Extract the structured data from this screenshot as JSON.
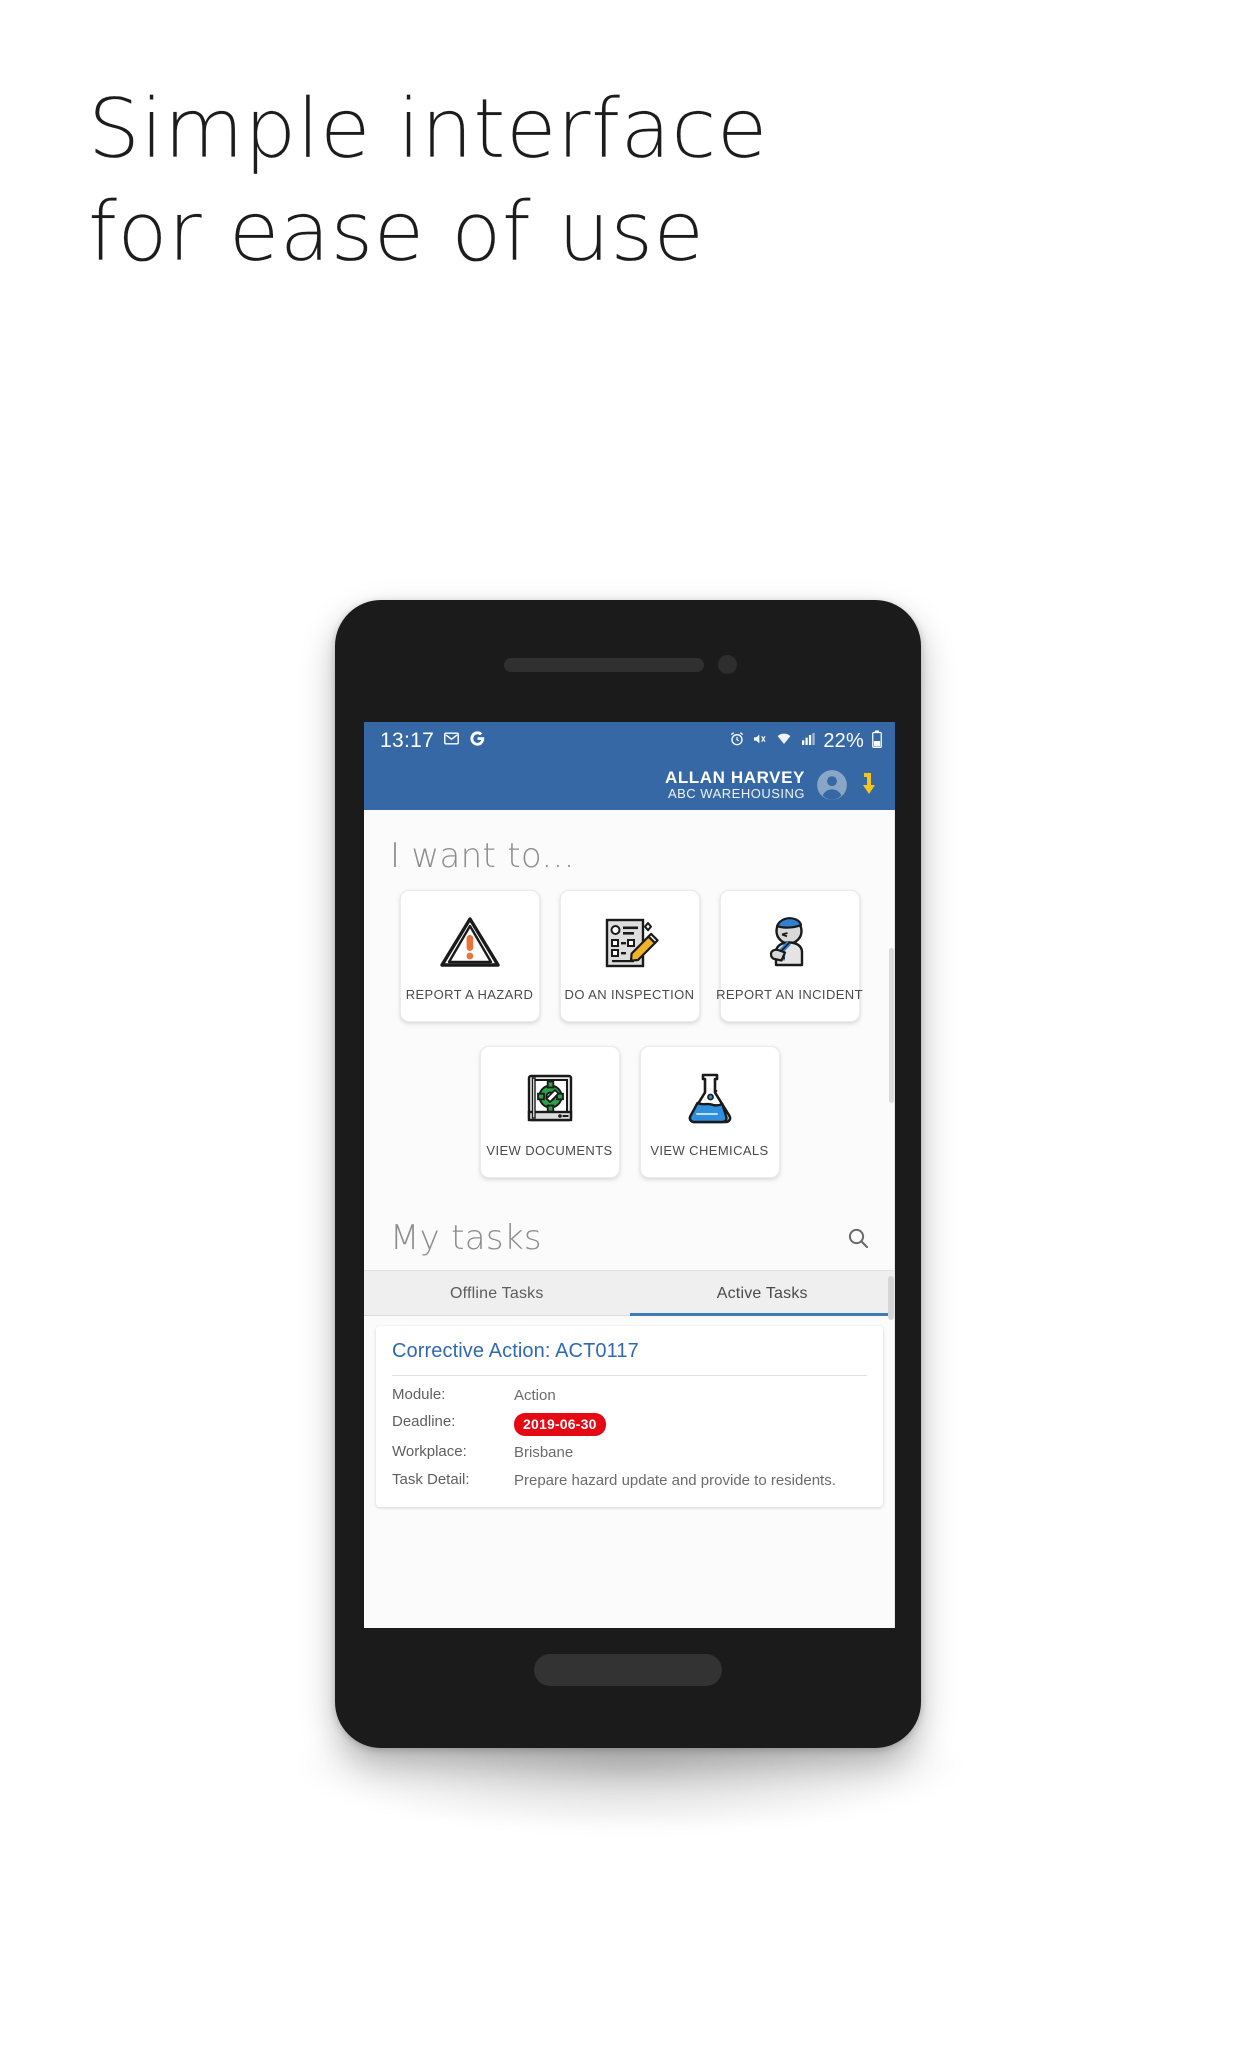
{
  "headline": {
    "line1": "Simple interface",
    "line2": "for ease of use"
  },
  "phone": {
    "statusbar": {
      "time": "13:17",
      "battery_percent": "22%",
      "icons": [
        "mail-icon",
        "google-icon",
        "alarm-icon",
        "mute-icon",
        "wifi-icon",
        "signal-icon",
        "battery-icon"
      ]
    },
    "appbar": {
      "user_name": "ALLAN HARVEY",
      "org_name": "ABC WAREHOUSING",
      "avatar_icon": "account-circle-icon",
      "logout_icon": "logout-arrow-icon",
      "accent_color": "#3568a4",
      "logout_color": "#f5c518"
    },
    "content": {
      "want_to_title": "I want to...",
      "tiles": [
        {
          "label": "REPORT A HAZARD",
          "icon": "warning-triangle-icon"
        },
        {
          "label": "DO AN INSPECTION",
          "icon": "clipboard-pencil-icon"
        },
        {
          "label": "REPORT AN INCIDENT",
          "icon": "injured-person-icon"
        },
        {
          "label": "VIEW DOCUMENTS",
          "icon": "book-gear-icon"
        },
        {
          "label": "VIEW CHEMICALS",
          "icon": "flask-icon"
        }
      ],
      "tasks_title": "My tasks",
      "search_icon": "search-icon",
      "tabs": [
        {
          "label": "Offline Tasks",
          "active": false
        },
        {
          "label": "Active Tasks",
          "active": true
        }
      ],
      "task_card": {
        "title": "Corrective Action: ACT0117",
        "rows": [
          {
            "key": "Module:",
            "value": "Action"
          },
          {
            "key": "Deadline:",
            "value": "2019-06-30",
            "badge": true,
            "badge_color": "#e50914"
          },
          {
            "key": "Workplace:",
            "value": "Brisbane"
          },
          {
            "key": "Task Detail:",
            "value": "Prepare hazard update and provide to residents."
          }
        ]
      }
    }
  }
}
